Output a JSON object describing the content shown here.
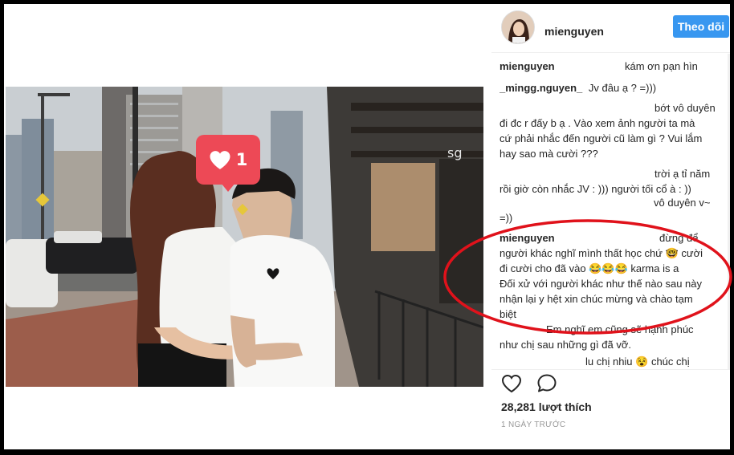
{
  "post": {
    "username": "mienguyen",
    "follow_label": "Theo dõi",
    "like_badge_count": "1",
    "likes_text": "28,281 lượt thích",
    "time_text": "1 NGÀY TRƯỚC"
  },
  "comments": [
    {
      "author": "mienguyen",
      "lines": [
        "kám ơn pạn hìn"
      ]
    },
    {
      "author": "_mingg.nguyen_",
      "lines": [
        "Jv đâu ạ ? =)))"
      ]
    },
    {
      "author": "",
      "lines": [
        "bớt vô duyên",
        "đi đc r đấy b ạ . Vào xem ảnh người ta mà",
        "cứ phải nhắc đến người cũ làm gì ? Vui lắm",
        "hay sao mà cười ???"
      ]
    },
    {
      "author": "",
      "lines": [
        "trời ạ tỉ năm",
        "rồi giờ còn nhắc JV : ))) người tối cổ à : ))"
      ]
    },
    {
      "author": "",
      "lines": [
        "vô duyên v~",
        "=))"
      ]
    },
    {
      "author": "mienguyen",
      "lines": [
        "đừng để",
        "người khác nghĩ mình thất học chứ 🤓 cười",
        "đi cười cho đã vào 😂😂😂 karma is a",
        "Đối xử với người khác như thế nào sau này",
        "nhận lại y hệt xin chúc mừng và chào tạm",
        "biệt"
      ]
    },
    {
      "author": "",
      "lines": [
        "Em nghĩ em cũng sẽ hạnh phúc",
        "như chị sau những gì đã vỡ."
      ]
    },
    {
      "author": "",
      "lines": [
        "lu chị nhiu 😵 chúc chị"
      ]
    }
  ],
  "icons": {
    "heart": "heart-outline-icon",
    "comment": "speech-bubble-icon",
    "badge_heart": "heart-icon"
  },
  "colors": {
    "follow_button": "#3897f0",
    "like_badge": "#ed4956",
    "annotation_circle": "#e0121b"
  }
}
